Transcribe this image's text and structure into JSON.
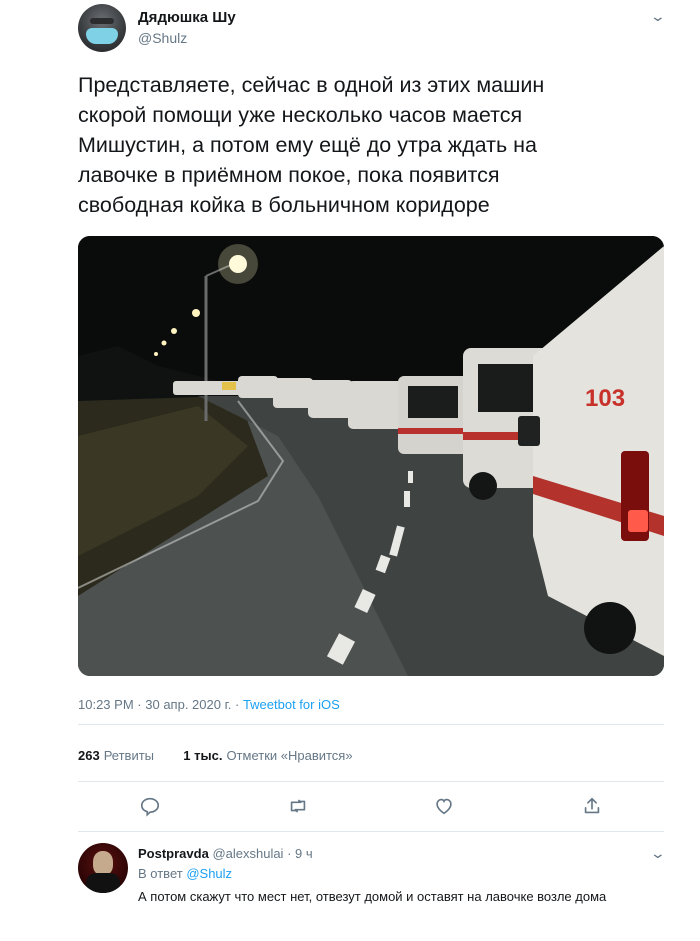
{
  "tweet": {
    "author_name": "Дядюшка Шу",
    "author_handle": "@Shulz",
    "text": "Представляете, сейчас в одной из этих машин\nскорой помощи уже несколько часов мается\nМишустин, а потом ему ещё до утра ждать на\nлавочке в приёмном покое, пока появится\nсвободная койка в больничном коридоре",
    "time": "10:23 PM",
    "date": "30 апр. 2020 г.",
    "separator": "·",
    "source": "Tweetbot for iOS",
    "retweets_count": "263",
    "retweets_label": "Ретвиты",
    "likes_count": "1 тыс.",
    "likes_label": "Отметки «Нравится»",
    "photo_text": "103",
    "more_icon": "chevron-down-icon"
  },
  "actions": [
    "reply-icon",
    "retweet-icon",
    "like-icon",
    "share-icon"
  ],
  "reply": {
    "author_name": "Postpravda",
    "author_handle": "@alexshulai",
    "separator": "·",
    "time": "9 ч",
    "reply_to_label": "В ответ",
    "reply_to_handle": "@Shulz",
    "text": "А потом скажут что мест нет, отвезут домой и оставят на лавочке возле дома"
  },
  "colors": {
    "text": "#14171a",
    "secondary": "#657786",
    "link": "#1da1f2",
    "divider": "#e1e8ed"
  }
}
